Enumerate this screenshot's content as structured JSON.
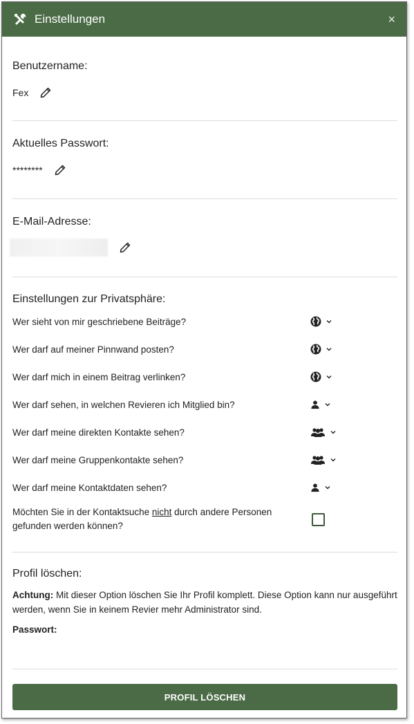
{
  "dialog": {
    "title": "Einstellungen",
    "close_glyph": "×"
  },
  "username": {
    "label": "Benutzername:",
    "value": "Fex"
  },
  "password": {
    "label": "Aktuelles Passwort:",
    "value": "********"
  },
  "email": {
    "label": "E-Mail-Adresse:"
  },
  "privacy": {
    "title": "Einstellungen zur Privatsphäre:",
    "items": [
      {
        "question": "Wer sieht von mir geschriebene Beiträge?",
        "icon": "globe-icon"
      },
      {
        "question": "Wer darf auf meiner Pinnwand posten?",
        "icon": "globe-icon"
      },
      {
        "question": "Wer darf mich in einem Beitrag verlinken?",
        "icon": "globe-icon"
      },
      {
        "question": "Wer darf sehen, in welchen Revieren ich Mitglied bin?",
        "icon": "user-icon"
      },
      {
        "question": "Wer darf meine direkten Kontakte sehen?",
        "icon": "users-icon"
      },
      {
        "question": "Wer darf meine Gruppenkontakte sehen?",
        "icon": "users-icon"
      },
      {
        "question": "Wer darf meine Kontaktdaten sehen?",
        "icon": "user-icon"
      }
    ],
    "search_opt": {
      "before": "Möchten Sie in der Kontaktsuche ",
      "emphasis": "nicht",
      "after": " durch andere Personen gefunden werden können?"
    }
  },
  "delete_profile": {
    "title": "Profil löschen:",
    "warning_label": "Achtung:",
    "warning_text": " Mit dieser Option löschen Sie Ihr Profil komplett. Diese Option kann nur ausgeführt werden, wenn Sie in keinem Revier mehr Administrator sind.",
    "password_label": "Passwort:",
    "button_label": "PROFIL LÖSCHEN"
  },
  "colors": {
    "header": "#4a6b45",
    "button": "#4a6b45",
    "checkbox": "#3d5a38"
  }
}
